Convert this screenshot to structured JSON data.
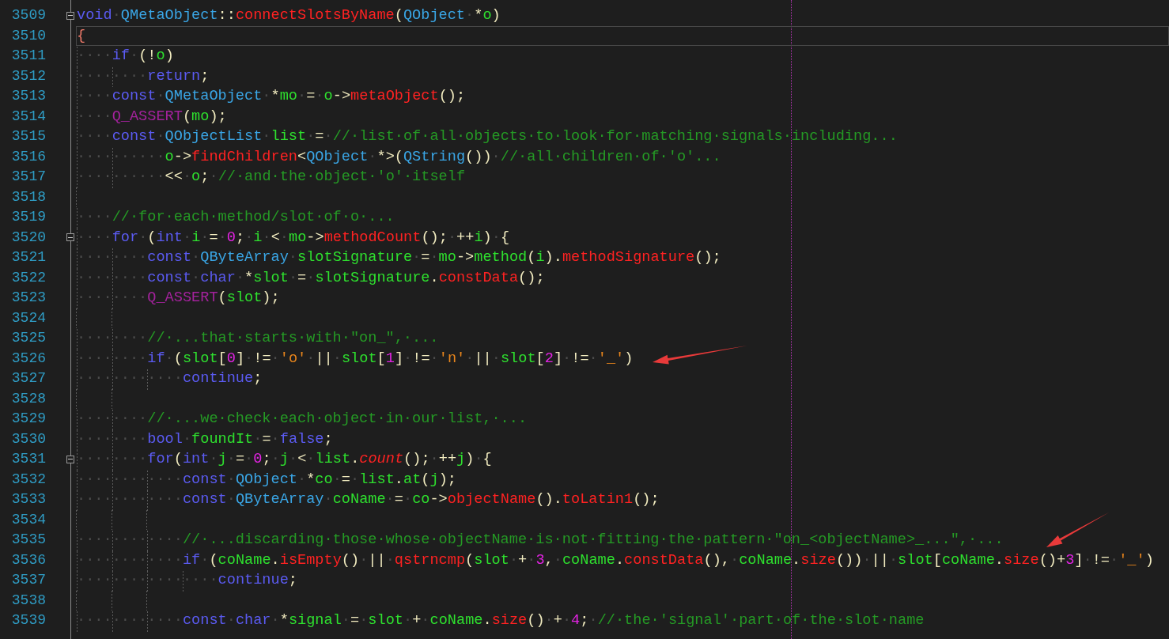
{
  "editor": {
    "lines": [
      {
        "number": "3509",
        "fold": true,
        "current": false,
        "tokens": [
          {
            "kind": "kw",
            "text": "void"
          },
          {
            "kind": "ws",
            "text": "·"
          },
          {
            "kind": "type",
            "text": "QMetaObject"
          },
          {
            "kind": "p",
            "text": "::"
          },
          {
            "kind": "fn",
            "text": "connectSlotsByName"
          },
          {
            "kind": "p",
            "text": "("
          },
          {
            "kind": "type",
            "text": "QObject"
          },
          {
            "kind": "ws",
            "text": "·"
          },
          {
            "kind": "p",
            "text": "*"
          },
          {
            "kind": "var",
            "text": "o"
          },
          {
            "kind": "p",
            "text": ")"
          }
        ]
      },
      {
        "number": "3510",
        "fold": false,
        "current": true,
        "tokens": [
          {
            "kind": "brace",
            "text": "{"
          }
        ]
      },
      {
        "number": "3511",
        "fold": false,
        "current": false,
        "tokens": [
          {
            "kind": "ws",
            "text": "····"
          },
          {
            "kind": "kw",
            "text": "if"
          },
          {
            "kind": "ws",
            "text": "·"
          },
          {
            "kind": "p",
            "text": "(!"
          },
          {
            "kind": "var",
            "text": "o"
          },
          {
            "kind": "p",
            "text": ")"
          }
        ]
      },
      {
        "number": "3512",
        "fold": false,
        "current": false,
        "tokens": [
          {
            "kind": "ws",
            "text": "········"
          },
          {
            "kind": "kw",
            "text": "return"
          },
          {
            "kind": "p",
            "text": ";"
          }
        ]
      },
      {
        "number": "3513",
        "fold": false,
        "current": false,
        "tokens": [
          {
            "kind": "ws",
            "text": "····"
          },
          {
            "kind": "kw",
            "text": "const"
          },
          {
            "kind": "ws",
            "text": "·"
          },
          {
            "kind": "type",
            "text": "QMetaObject"
          },
          {
            "kind": "ws",
            "text": "·"
          },
          {
            "kind": "p",
            "text": "*"
          },
          {
            "kind": "var",
            "text": "mo"
          },
          {
            "kind": "ws",
            "text": "·"
          },
          {
            "kind": "p",
            "text": "="
          },
          {
            "kind": "ws",
            "text": "·"
          },
          {
            "kind": "var",
            "text": "o"
          },
          {
            "kind": "p",
            "text": "->"
          },
          {
            "kind": "fn",
            "text": "metaObject"
          },
          {
            "kind": "p",
            "text": "();"
          }
        ]
      },
      {
        "number": "3514",
        "fold": false,
        "current": false,
        "tokens": [
          {
            "kind": "ws",
            "text": "····"
          },
          {
            "kind": "macro",
            "text": "Q_ASSERT"
          },
          {
            "kind": "p",
            "text": "("
          },
          {
            "kind": "var",
            "text": "mo"
          },
          {
            "kind": "p",
            "text": ");"
          }
        ]
      },
      {
        "number": "3515",
        "fold": false,
        "current": false,
        "tokens": [
          {
            "kind": "ws",
            "text": "····"
          },
          {
            "kind": "kw",
            "text": "const"
          },
          {
            "kind": "ws",
            "text": "·"
          },
          {
            "kind": "type",
            "text": "QObjectList"
          },
          {
            "kind": "ws",
            "text": "·"
          },
          {
            "kind": "var",
            "text": "list"
          },
          {
            "kind": "ws",
            "text": "·"
          },
          {
            "kind": "p",
            "text": "="
          },
          {
            "kind": "ws",
            "text": "·"
          },
          {
            "kind": "cm",
            "text": "//·list·of·all·objects·to·look·for·matching·signals·including..."
          }
        ]
      },
      {
        "number": "3516",
        "fold": false,
        "current": false,
        "tokens": [
          {
            "kind": "ws",
            "text": "··········"
          },
          {
            "kind": "var",
            "text": "o"
          },
          {
            "kind": "p",
            "text": "->"
          },
          {
            "kind": "fn",
            "text": "findChildren"
          },
          {
            "kind": "p",
            "text": "<"
          },
          {
            "kind": "type",
            "text": "QObject"
          },
          {
            "kind": "ws",
            "text": "·"
          },
          {
            "kind": "p",
            "text": "*>("
          },
          {
            "kind": "type",
            "text": "QString"
          },
          {
            "kind": "p",
            "text": "())"
          },
          {
            "kind": "ws",
            "text": "·"
          },
          {
            "kind": "cm",
            "text": "//·all·children·of·'o'..."
          }
        ]
      },
      {
        "number": "3517",
        "fold": false,
        "current": false,
        "tokens": [
          {
            "kind": "ws",
            "text": "··········"
          },
          {
            "kind": "p",
            "text": "<<"
          },
          {
            "kind": "ws",
            "text": "·"
          },
          {
            "kind": "var",
            "text": "o"
          },
          {
            "kind": "p",
            "text": ";"
          },
          {
            "kind": "ws",
            "text": "·"
          },
          {
            "kind": "cm",
            "text": "//·and·the·object·'o'·itself"
          }
        ]
      },
      {
        "number": "3518",
        "fold": false,
        "current": false
      },
      {
        "number": "3519",
        "fold": false,
        "current": false,
        "tokens": [
          {
            "kind": "ws",
            "text": "····"
          },
          {
            "kind": "cm",
            "text": "//·for·each·method/slot·of·o·..."
          }
        ]
      },
      {
        "number": "3520",
        "fold": true,
        "current": false,
        "tokens": [
          {
            "kind": "ws",
            "text": "····"
          },
          {
            "kind": "kw",
            "text": "for"
          },
          {
            "kind": "ws",
            "text": "·"
          },
          {
            "kind": "p",
            "text": "("
          },
          {
            "kind": "kw",
            "text": "int"
          },
          {
            "kind": "ws",
            "text": "·"
          },
          {
            "kind": "var",
            "text": "i"
          },
          {
            "kind": "ws",
            "text": "·"
          },
          {
            "kind": "p",
            "text": "="
          },
          {
            "kind": "ws",
            "text": "·"
          },
          {
            "kind": "num",
            "text": "0"
          },
          {
            "kind": "p",
            "text": ";"
          },
          {
            "kind": "ws",
            "text": "·"
          },
          {
            "kind": "var",
            "text": "i"
          },
          {
            "kind": "ws",
            "text": "·"
          },
          {
            "kind": "p",
            "text": "<"
          },
          {
            "kind": "ws",
            "text": "·"
          },
          {
            "kind": "var",
            "text": "mo"
          },
          {
            "kind": "p",
            "text": "->"
          },
          {
            "kind": "fn",
            "text": "methodCount"
          },
          {
            "kind": "p",
            "text": "();"
          },
          {
            "kind": "ws",
            "text": "·"
          },
          {
            "kind": "p",
            "text": "++"
          },
          {
            "kind": "var",
            "text": "i"
          },
          {
            "kind": "p",
            "text": ")"
          },
          {
            "kind": "ws",
            "text": "·"
          },
          {
            "kind": "p",
            "text": "{"
          }
        ]
      },
      {
        "number": "3521",
        "fold": false,
        "current": false,
        "tokens": [
          {
            "kind": "ws",
            "text": "········"
          },
          {
            "kind": "kw",
            "text": "const"
          },
          {
            "kind": "ws",
            "text": "·"
          },
          {
            "kind": "type",
            "text": "QByteArray"
          },
          {
            "kind": "ws",
            "text": "·"
          },
          {
            "kind": "var",
            "text": "slotSignature"
          },
          {
            "kind": "ws",
            "text": "·"
          },
          {
            "kind": "p",
            "text": "="
          },
          {
            "kind": "ws",
            "text": "·"
          },
          {
            "kind": "var",
            "text": "mo"
          },
          {
            "kind": "p",
            "text": "->"
          },
          {
            "kind": "var",
            "text": "method"
          },
          {
            "kind": "p",
            "text": "("
          },
          {
            "kind": "var",
            "text": "i"
          },
          {
            "kind": "p",
            "text": ")."
          },
          {
            "kind": "fn",
            "text": "methodSignature"
          },
          {
            "kind": "p",
            "text": "();"
          }
        ]
      },
      {
        "number": "3522",
        "fold": false,
        "current": false,
        "tokens": [
          {
            "kind": "ws",
            "text": "········"
          },
          {
            "kind": "kw",
            "text": "const"
          },
          {
            "kind": "ws",
            "text": "·"
          },
          {
            "kind": "kw",
            "text": "char"
          },
          {
            "kind": "ws",
            "text": "·"
          },
          {
            "kind": "p",
            "text": "*"
          },
          {
            "kind": "var",
            "text": "slot"
          },
          {
            "kind": "ws",
            "text": "·"
          },
          {
            "kind": "p",
            "text": "="
          },
          {
            "kind": "ws",
            "text": "·"
          },
          {
            "kind": "var",
            "text": "slotSignature"
          },
          {
            "kind": "p",
            "text": "."
          },
          {
            "kind": "fn",
            "text": "constData"
          },
          {
            "kind": "p",
            "text": "();"
          }
        ]
      },
      {
        "number": "3523",
        "fold": false,
        "current": false,
        "tokens": [
          {
            "kind": "ws",
            "text": "········"
          },
          {
            "kind": "macro",
            "text": "Q_ASSERT"
          },
          {
            "kind": "p",
            "text": "("
          },
          {
            "kind": "var",
            "text": "slot"
          },
          {
            "kind": "p",
            "text": ");"
          }
        ]
      },
      {
        "number": "3524",
        "fold": false,
        "current": false
      },
      {
        "number": "3525",
        "fold": false,
        "current": false,
        "tokens": [
          {
            "kind": "ws",
            "text": "········"
          },
          {
            "kind": "cm",
            "text": "//·...that·starts·with·\"on_\",·..."
          }
        ]
      },
      {
        "number": "3526",
        "fold": false,
        "current": false,
        "tokens": [
          {
            "kind": "ws",
            "text": "········"
          },
          {
            "kind": "kw",
            "text": "if"
          },
          {
            "kind": "ws",
            "text": "·"
          },
          {
            "kind": "p",
            "text": "("
          },
          {
            "kind": "var",
            "text": "slot"
          },
          {
            "kind": "p",
            "text": "["
          },
          {
            "kind": "num",
            "text": "0"
          },
          {
            "kind": "p",
            "text": "]"
          },
          {
            "kind": "ws",
            "text": "·"
          },
          {
            "kind": "p",
            "text": "!="
          },
          {
            "kind": "ws",
            "text": "·"
          },
          {
            "kind": "str",
            "text": "'o'"
          },
          {
            "kind": "ws",
            "text": "·"
          },
          {
            "kind": "p",
            "text": "||"
          },
          {
            "kind": "ws",
            "text": "·"
          },
          {
            "kind": "var",
            "text": "slot"
          },
          {
            "kind": "p",
            "text": "["
          },
          {
            "kind": "num",
            "text": "1"
          },
          {
            "kind": "p",
            "text": "]"
          },
          {
            "kind": "ws",
            "text": "·"
          },
          {
            "kind": "p",
            "text": "!="
          },
          {
            "kind": "ws",
            "text": "·"
          },
          {
            "kind": "str",
            "text": "'n'"
          },
          {
            "kind": "ws",
            "text": "·"
          },
          {
            "kind": "p",
            "text": "||"
          },
          {
            "kind": "ws",
            "text": "·"
          },
          {
            "kind": "var",
            "text": "slot"
          },
          {
            "kind": "p",
            "text": "["
          },
          {
            "kind": "num",
            "text": "2"
          },
          {
            "kind": "p",
            "text": "]"
          },
          {
            "kind": "ws",
            "text": "·"
          },
          {
            "kind": "p",
            "text": "!="
          },
          {
            "kind": "ws",
            "text": "·"
          },
          {
            "kind": "str",
            "text": "'_'"
          },
          {
            "kind": "p",
            "text": ")"
          }
        ]
      },
      {
        "number": "3527",
        "fold": false,
        "current": false,
        "tokens": [
          {
            "kind": "ws",
            "text": "············"
          },
          {
            "kind": "kw",
            "text": "continue"
          },
          {
            "kind": "p",
            "text": ";"
          }
        ]
      },
      {
        "number": "3528",
        "fold": false,
        "current": false
      },
      {
        "number": "3529",
        "fold": false,
        "current": false,
        "tokens": [
          {
            "kind": "ws",
            "text": "········"
          },
          {
            "kind": "cm",
            "text": "//·...we·check·each·object·in·our·list,·..."
          }
        ]
      },
      {
        "number": "3530",
        "fold": false,
        "current": false,
        "tokens": [
          {
            "kind": "ws",
            "text": "········"
          },
          {
            "kind": "kw",
            "text": "bool"
          },
          {
            "kind": "ws",
            "text": "·"
          },
          {
            "kind": "var",
            "text": "foundIt"
          },
          {
            "kind": "ws",
            "text": "·"
          },
          {
            "kind": "p",
            "text": "="
          },
          {
            "kind": "ws",
            "text": "·"
          },
          {
            "kind": "kw",
            "text": "false"
          },
          {
            "kind": "p",
            "text": ";"
          }
        ]
      },
      {
        "number": "3531",
        "fold": true,
        "current": false,
        "tokens": [
          {
            "kind": "ws",
            "text": "········"
          },
          {
            "kind": "kw",
            "text": "for"
          },
          {
            "kind": "p",
            "text": "("
          },
          {
            "kind": "kw",
            "text": "int"
          },
          {
            "kind": "ws",
            "text": "·"
          },
          {
            "kind": "var",
            "text": "j"
          },
          {
            "kind": "ws",
            "text": "·"
          },
          {
            "kind": "p",
            "text": "="
          },
          {
            "kind": "ws",
            "text": "·"
          },
          {
            "kind": "num",
            "text": "0"
          },
          {
            "kind": "p",
            "text": ";"
          },
          {
            "kind": "ws",
            "text": "·"
          },
          {
            "kind": "var",
            "text": "j"
          },
          {
            "kind": "ws",
            "text": "·"
          },
          {
            "kind": "p",
            "text": "<"
          },
          {
            "kind": "ws",
            "text": "·"
          },
          {
            "kind": "var",
            "text": "list"
          },
          {
            "kind": "p",
            "text": "."
          },
          {
            "kind": "fni",
            "text": "count"
          },
          {
            "kind": "p",
            "text": "();"
          },
          {
            "kind": "ws",
            "text": "·"
          },
          {
            "kind": "p",
            "text": "++"
          },
          {
            "kind": "var",
            "text": "j"
          },
          {
            "kind": "p",
            "text": ")"
          },
          {
            "kind": "ws",
            "text": "·"
          },
          {
            "kind": "p",
            "text": "{"
          }
        ]
      },
      {
        "number": "3532",
        "fold": false,
        "current": false,
        "tokens": [
          {
            "kind": "ws",
            "text": "············"
          },
          {
            "kind": "kw",
            "text": "const"
          },
          {
            "kind": "ws",
            "text": "·"
          },
          {
            "kind": "type",
            "text": "QObject"
          },
          {
            "kind": "ws",
            "text": "·"
          },
          {
            "kind": "p",
            "text": "*"
          },
          {
            "kind": "var",
            "text": "co"
          },
          {
            "kind": "ws",
            "text": "·"
          },
          {
            "kind": "p",
            "text": "="
          },
          {
            "kind": "ws",
            "text": "·"
          },
          {
            "kind": "var",
            "text": "list"
          },
          {
            "kind": "p",
            "text": "."
          },
          {
            "kind": "var",
            "text": "at"
          },
          {
            "kind": "p",
            "text": "("
          },
          {
            "kind": "var",
            "text": "j"
          },
          {
            "kind": "p",
            "text": ");"
          }
        ]
      },
      {
        "number": "3533",
        "fold": false,
        "current": false,
        "tokens": [
          {
            "kind": "ws",
            "text": "············"
          },
          {
            "kind": "kw",
            "text": "const"
          },
          {
            "kind": "ws",
            "text": "·"
          },
          {
            "kind": "type",
            "text": "QByteArray"
          },
          {
            "kind": "ws",
            "text": "·"
          },
          {
            "kind": "var",
            "text": "coName"
          },
          {
            "kind": "ws",
            "text": "·"
          },
          {
            "kind": "p",
            "text": "="
          },
          {
            "kind": "ws",
            "text": "·"
          },
          {
            "kind": "var",
            "text": "co"
          },
          {
            "kind": "p",
            "text": "->"
          },
          {
            "kind": "fn",
            "text": "objectName"
          },
          {
            "kind": "p",
            "text": "()."
          },
          {
            "kind": "fn",
            "text": "toLatin1"
          },
          {
            "kind": "p",
            "text": "();"
          }
        ]
      },
      {
        "number": "3534",
        "fold": false,
        "current": false
      },
      {
        "number": "3535",
        "fold": false,
        "current": false,
        "tokens": [
          {
            "kind": "ws",
            "text": "············"
          },
          {
            "kind": "cm",
            "text": "//·...discarding·those·whose·objectName·is·not·fitting·the·pattern·\"on_<objectName>_...\",·..."
          }
        ]
      },
      {
        "number": "3536",
        "fold": false,
        "current": false,
        "tokens": [
          {
            "kind": "ws",
            "text": "············"
          },
          {
            "kind": "kw",
            "text": "if"
          },
          {
            "kind": "ws",
            "text": "·"
          },
          {
            "kind": "p",
            "text": "("
          },
          {
            "kind": "var",
            "text": "coName"
          },
          {
            "kind": "p",
            "text": "."
          },
          {
            "kind": "fn",
            "text": "isEmpty"
          },
          {
            "kind": "p",
            "text": "()"
          },
          {
            "kind": "ws",
            "text": "·"
          },
          {
            "kind": "p",
            "text": "||"
          },
          {
            "kind": "ws",
            "text": "·"
          },
          {
            "kind": "fn",
            "text": "qstrncmp"
          },
          {
            "kind": "p",
            "text": "("
          },
          {
            "kind": "var",
            "text": "slot"
          },
          {
            "kind": "ws",
            "text": "·"
          },
          {
            "kind": "p",
            "text": "+"
          },
          {
            "kind": "ws",
            "text": "·"
          },
          {
            "kind": "num",
            "text": "3"
          },
          {
            "kind": "p",
            "text": ","
          },
          {
            "kind": "ws",
            "text": "·"
          },
          {
            "kind": "var",
            "text": "coName"
          },
          {
            "kind": "p",
            "text": "."
          },
          {
            "kind": "fn",
            "text": "constData"
          },
          {
            "kind": "p",
            "text": "(),"
          },
          {
            "kind": "ws",
            "text": "·"
          },
          {
            "kind": "var",
            "text": "coName"
          },
          {
            "kind": "p",
            "text": "."
          },
          {
            "kind": "fn",
            "text": "size"
          },
          {
            "kind": "p",
            "text": "())"
          },
          {
            "kind": "ws",
            "text": "·"
          },
          {
            "kind": "p",
            "text": "||"
          },
          {
            "kind": "ws",
            "text": "·"
          },
          {
            "kind": "var",
            "text": "slot"
          },
          {
            "kind": "p",
            "text": "["
          },
          {
            "kind": "var",
            "text": "coName"
          },
          {
            "kind": "p",
            "text": "."
          },
          {
            "kind": "fn",
            "text": "size"
          },
          {
            "kind": "p",
            "text": "()+"
          },
          {
            "kind": "num",
            "text": "3"
          },
          {
            "kind": "p",
            "text": "]"
          },
          {
            "kind": "ws",
            "text": "·"
          },
          {
            "kind": "p",
            "text": "!="
          },
          {
            "kind": "ws",
            "text": "·"
          },
          {
            "kind": "str",
            "text": "'_'"
          },
          {
            "kind": "p",
            "text": ")"
          }
        ]
      },
      {
        "number": "3537",
        "fold": false,
        "current": false,
        "tokens": [
          {
            "kind": "ws",
            "text": "················"
          },
          {
            "kind": "kw",
            "text": "continue"
          },
          {
            "kind": "p",
            "text": ";"
          }
        ]
      },
      {
        "number": "3538",
        "fold": false,
        "current": false
      },
      {
        "number": "3539",
        "fold": false,
        "current": false,
        "tokens": [
          {
            "kind": "ws",
            "text": "············"
          },
          {
            "kind": "kw",
            "text": "const"
          },
          {
            "kind": "ws",
            "text": "·"
          },
          {
            "kind": "kw",
            "text": "char"
          },
          {
            "kind": "ws",
            "text": "·"
          },
          {
            "kind": "p",
            "text": "*"
          },
          {
            "kind": "var",
            "text": "signal"
          },
          {
            "kind": "ws",
            "text": "·"
          },
          {
            "kind": "p",
            "text": "="
          },
          {
            "kind": "ws",
            "text": "·"
          },
          {
            "kind": "var",
            "text": "slot"
          },
          {
            "kind": "ws",
            "text": "·"
          },
          {
            "kind": "p",
            "text": "+"
          },
          {
            "kind": "ws",
            "text": "·"
          },
          {
            "kind": "var",
            "text": "coName"
          },
          {
            "kind": "p",
            "text": "."
          },
          {
            "kind": "fn",
            "text": "size"
          },
          {
            "kind": "p",
            "text": "()"
          },
          {
            "kind": "ws",
            "text": "·"
          },
          {
            "kind": "p",
            "text": "+"
          },
          {
            "kind": "ws",
            "text": "·"
          },
          {
            "kind": "num",
            "text": "4"
          },
          {
            "kind": "p",
            "text": ";"
          },
          {
            "kind": "ws",
            "text": "·"
          },
          {
            "kind": "cm",
            "text": "//·the·'signal'·part·of·the·slot·name"
          }
        ]
      }
    ]
  }
}
